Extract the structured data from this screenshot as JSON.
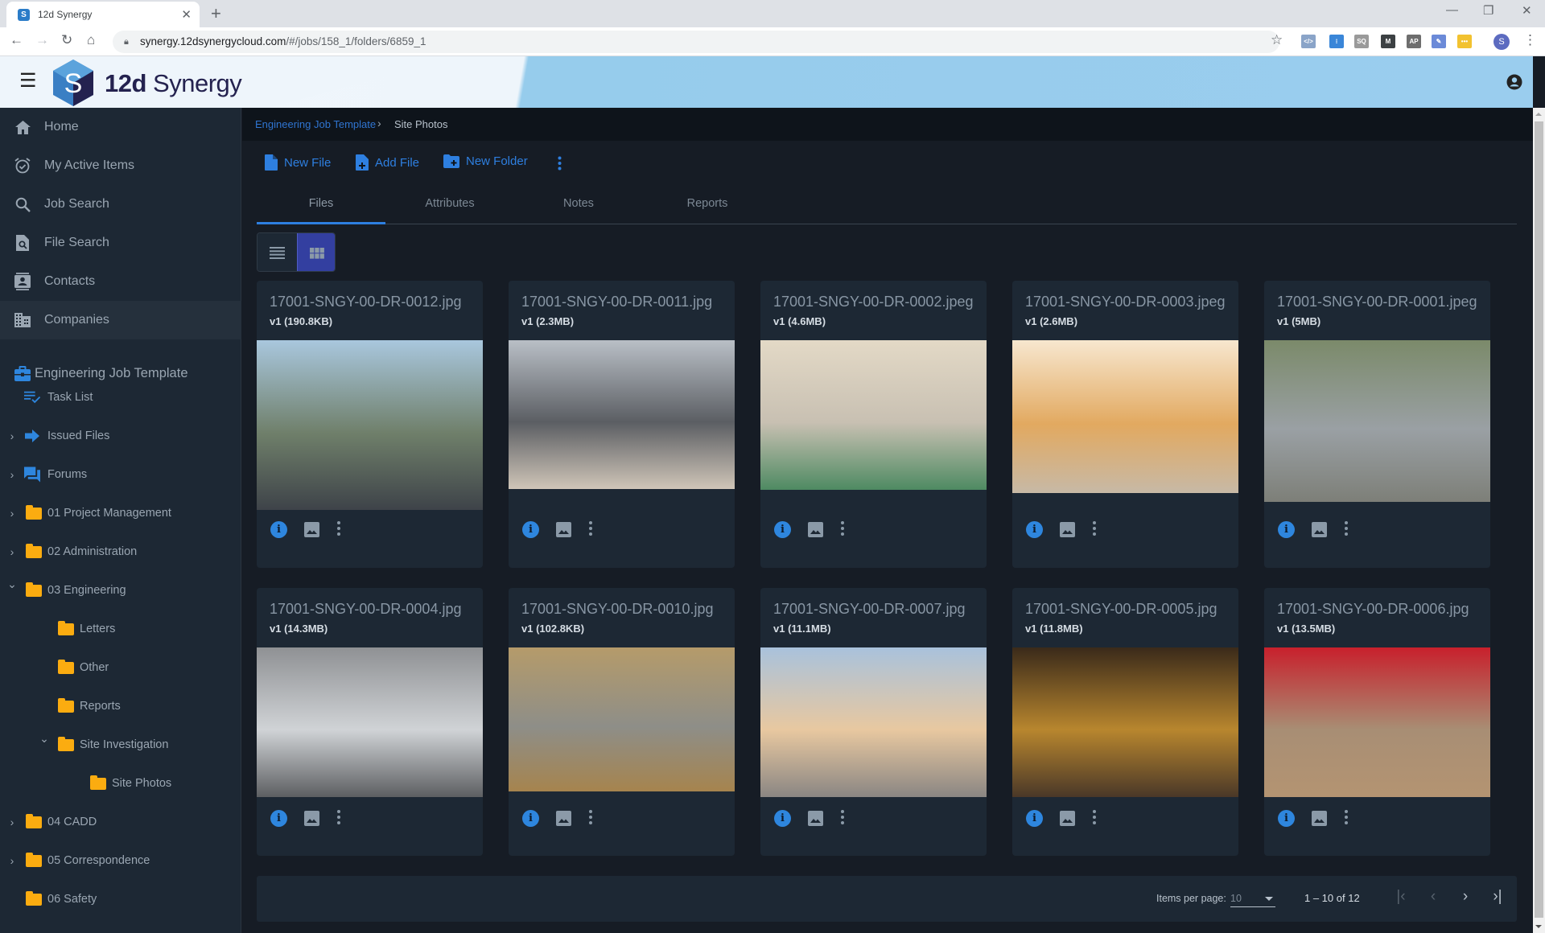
{
  "browser": {
    "tab_title": "12d Synergy",
    "favicon_letter": "S",
    "url_host": "synergy.12dsynergycloud.com",
    "url_path": "/#/jobs/158_1/folders/6859_1",
    "profile_initial": "S",
    "extensions": [
      {
        "name": "code-view-extension",
        "glyph": "</>",
        "color": "#8aa4c8"
      },
      {
        "name": "tag-extension",
        "glyph": "⁝",
        "color": "#3a86d8"
      },
      {
        "name": "seo-extension",
        "glyph": "SQ",
        "color": "#9a9a9a"
      },
      {
        "name": "m-extension",
        "glyph": "M",
        "color": "#3c4043"
      },
      {
        "name": "ap-extension",
        "glyph": "AP",
        "color": "#6e6e6e"
      },
      {
        "name": "eyedropper-extension",
        "glyph": "✎",
        "color": "#6b8ad8"
      },
      {
        "name": "yellow-extension",
        "glyph": "•••",
        "color": "#f2c230"
      }
    ]
  },
  "app": {
    "brand_bold": "12d",
    "brand_rest": " Synergy",
    "logo_letter": "S"
  },
  "sidebar": {
    "nav": [
      {
        "label": "Home",
        "icon": "home-icon"
      },
      {
        "label": "My Active Items",
        "icon": "alarm-check-icon"
      },
      {
        "label": "Job Search",
        "icon": "search-icon"
      },
      {
        "label": "File Search",
        "icon": "file-search-icon"
      },
      {
        "label": "Contacts",
        "icon": "contacts-icon"
      },
      {
        "label": "Companies",
        "icon": "building-icon",
        "active": true
      }
    ],
    "job": {
      "label": "Engineering Job Template",
      "icon": "briefcase-icon"
    },
    "tree": [
      {
        "label": "Task List",
        "icon": "task-list-icon",
        "chevron": ""
      },
      {
        "label": "Issued Files",
        "icon": "arrow-right-icon",
        "chevron": "›"
      },
      {
        "label": "Forums",
        "icon": "forum-icon",
        "chevron": "›"
      },
      {
        "label": "01 Project Management",
        "icon": "folder-icon",
        "chevron": "›"
      },
      {
        "label": "02 Administration",
        "icon": "folder-icon",
        "chevron": "›"
      },
      {
        "label": "03 Engineering",
        "icon": "folder-icon",
        "chevron": "⌄"
      },
      {
        "label": "Letters",
        "icon": "folder-icon",
        "chevron": ""
      },
      {
        "label": "Other",
        "icon": "folder-icon",
        "chevron": ""
      },
      {
        "label": "Reports",
        "icon": "folder-icon",
        "chevron": ""
      },
      {
        "label": "Site Investigation",
        "icon": "folder-icon",
        "chevron": "⌄"
      },
      {
        "label": "Site Photos",
        "icon": "folder-icon",
        "chevron": ""
      },
      {
        "label": "04 CADD",
        "icon": "folder-icon",
        "chevron": "›"
      },
      {
        "label": "05 Correspondence",
        "icon": "folder-icon",
        "chevron": "›"
      },
      {
        "label": "06 Safety",
        "icon": "folder-icon",
        "chevron": ""
      }
    ]
  },
  "breadcrumb": {
    "parent": "Engineering Job Template",
    "separator": "›",
    "current": "Site Photos"
  },
  "toolbar": {
    "new_file": "New File",
    "add_file": "Add File",
    "new_folder": "New Folder"
  },
  "tabs": [
    {
      "label": "Files",
      "active": true
    },
    {
      "label": "Attributes"
    },
    {
      "label": "Notes"
    },
    {
      "label": "Reports"
    }
  ],
  "view": {
    "mode": "grid"
  },
  "files": [
    {
      "name": "17001-SNGY-00-DR-0012.jpg",
      "version": "v1 (190.8KB)",
      "colors": [
        "#a9c7de",
        "#6f7f6a",
        "#3e4349"
      ]
    },
    {
      "name": "17001-SNGY-00-DR-0011.jpg",
      "version": "v1 (2.3MB)",
      "colors": [
        "#b9bfc6",
        "#5b5e63",
        "#cfc5b8"
      ]
    },
    {
      "name": "17001-SNGY-00-DR-0002.jpeg",
      "version": "v1 (4.6MB)",
      "colors": [
        "#e3d9c6",
        "#c8c0b2",
        "#4e8a62"
      ]
    },
    {
      "name": "17001-SNGY-00-DR-0003.jpeg",
      "version": "v1 (2.6MB)",
      "colors": [
        "#f7e7cf",
        "#e2a960",
        "#c7b9a6"
      ]
    },
    {
      "name": "17001-SNGY-00-DR-0001.jpeg",
      "version": "v1 (5MB)",
      "colors": [
        "#7b8a6a",
        "#9aa0a4",
        "#7d7f78"
      ]
    },
    {
      "name": "17001-SNGY-00-DR-0004.jpg",
      "version": "v1 (14.3MB)",
      "colors": [
        "#8f9194",
        "#d0d3d6",
        "#5d5f62"
      ]
    },
    {
      "name": "17001-SNGY-00-DR-0010.jpg",
      "version": "v1 (102.8KB)",
      "colors": [
        "#b59b6a",
        "#8e8e88",
        "#a6844e"
      ]
    },
    {
      "name": "17001-SNGY-00-DR-0007.jpg",
      "version": "v1 (11.1MB)",
      "colors": [
        "#a9c2dc",
        "#e8c8a0",
        "#8a8683"
      ]
    },
    {
      "name": "17001-SNGY-00-DR-0005.jpg",
      "version": "v1 (11.8MB)",
      "colors": [
        "#3a2a1a",
        "#b8862e",
        "#4a3828"
      ]
    },
    {
      "name": "17001-SNGY-00-DR-0006.jpg",
      "version": "v1 (13.5MB)",
      "colors": [
        "#c8202c",
        "#a88e74",
        "#b49472"
      ]
    }
  ],
  "pagination": {
    "items_per_page_label": "Items per page:",
    "items_per_page": "10",
    "range": "1 – 10 of 12",
    "first": "|‹",
    "prev": "‹",
    "next": "›",
    "last": "›|"
  }
}
